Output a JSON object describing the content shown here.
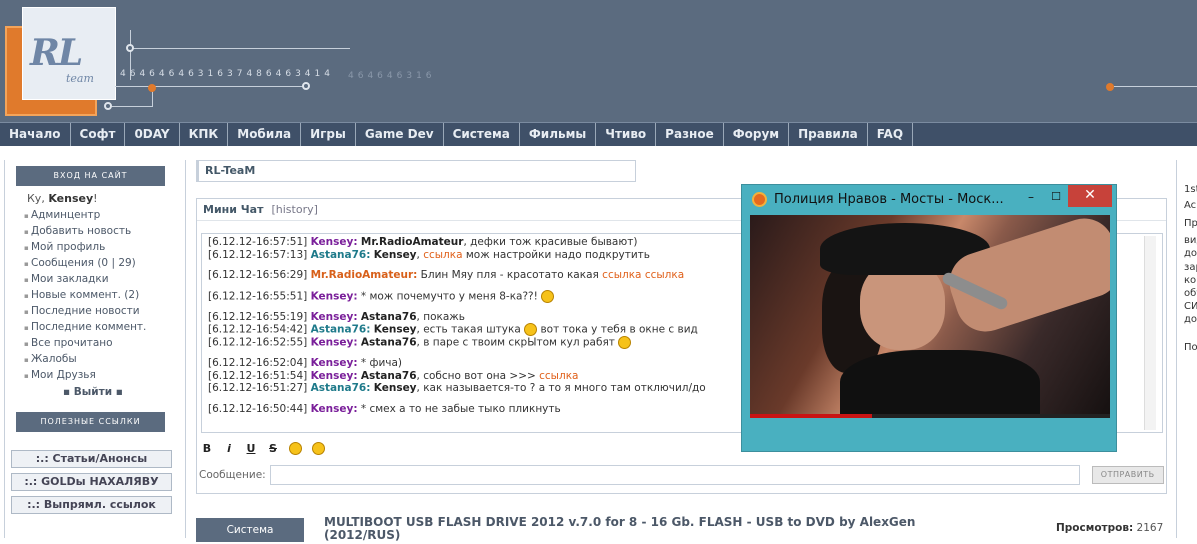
{
  "header": {
    "logo_text": "RL",
    "logo_sub": "team",
    "digits_bright": "4646464631637486463414",
    "digits_dim": "464646316"
  },
  "nav": [
    "Начало",
    "Софт",
    "0DAY",
    "КПК",
    "Мобила",
    "Игры",
    "Game Dev",
    "Система",
    "Фильмы",
    "Чтиво",
    "Разное",
    "Форум",
    "Правила",
    "FAQ"
  ],
  "sidebar": {
    "login_title": "ВХОД НА САЙТ",
    "greeting_prefix": "Ку,",
    "username": "Kensey",
    "greeting_suffix": "!",
    "menu": [
      "Админцентр",
      "Добавить новость",
      "Мой профиль",
      "Сообщения (0 | 29)",
      "Мои закладки",
      "Новые коммент. (2)",
      "Последние новости",
      "Последние коммент.",
      "Все прочитано",
      "Жалобы",
      "Мои Друзья"
    ],
    "logout": "Выйти",
    "links_title": "ПОЛЕЗНЫЕ ССЫЛКИ",
    "buttons": [
      ":.: Статьи/Анонсы",
      ":.: GOLDы НАХАЛЯВУ",
      ":.: Выпрямл. ссылок"
    ]
  },
  "main": {
    "site_title": "RL-TeaM",
    "chat_title": "Мини Чат",
    "chat_history": "[history]",
    "messages": [
      {
        "time": "[6.12.12-16:57:51]",
        "user": "Kensey:",
        "ucls": "u1",
        "to": "Mr.RadioAmateur",
        "text": ", дефки тож красивые бывают)",
        "link": "",
        "after": ""
      },
      {
        "time": "[6.12.12-16:57:13]",
        "user": "Astana76:",
        "ucls": "u2",
        "to": "Kensey",
        "text": ", ",
        "link": "ссылка",
        "after": " мож настройки надо подкрутить"
      },
      {
        "time": "[6.12.12-16:56:29]",
        "user": "Mr.RadioAmateur:",
        "ucls": "u3",
        "to": "",
        "text": "Блин Мяу пля - красотато какая ",
        "link": "ссылка ссылка",
        "after": ""
      },
      {
        "time": "[6.12.12-16:55:51]",
        "user": "Kensey:",
        "ucls": "u1",
        "to": "",
        "text": "* мож почемучто у меня 8-ка??!",
        "link": "",
        "after": ""
      },
      {
        "time": "[6.12.12-16:55:19]",
        "user": "Kensey:",
        "ucls": "u1",
        "to": "Astana76",
        "text": ", покажь",
        "link": "",
        "after": ""
      },
      {
        "time": "[6.12.12-16:54:42]",
        "user": "Astana76:",
        "ucls": "u2",
        "to": "Kensey",
        "text": ", есть такая штука",
        "link": "",
        "after": " вот тока у тебя в окне с вид"
      },
      {
        "time": "[6.12.12-16:52:55]",
        "user": "Kensey:",
        "ucls": "u1",
        "to": "Astana76",
        "text": ", в паре с твоим скрЫтом кул рабят",
        "link": "",
        "after": ""
      },
      {
        "time": "[6.12.12-16:52:04]",
        "user": "Kensey:",
        "ucls": "u1",
        "to": "",
        "text": "* фича)",
        "link": "",
        "after": ""
      },
      {
        "time": "[6.12.12-16:51:54]",
        "user": "Kensey:",
        "ucls": "u1",
        "to": "Astana76",
        "text": ", собсно вот она >>> ",
        "link": "ссылка",
        "after": ""
      },
      {
        "time": "[6.12.12-16:51:27]",
        "user": "Astana76:",
        "ucls": "u2",
        "to": "Kensey",
        "text": ", как называется-то ? а то я много там отключил/до",
        "link": "",
        "after": ""
      },
      {
        "time": "[6.12.12-16:50:44]",
        "user": "Kensey:",
        "ucls": "u1",
        "to": "",
        "text": "* смех а то не забые тыко пликнуть",
        "link": "",
        "after": ""
      }
    ],
    "toolbar": [
      "B",
      "i",
      "U",
      "S"
    ],
    "message_label": "Сообщение:",
    "send_label": "ОТПРАВИТЬ",
    "news": {
      "category": "Система",
      "title": "MULTIBOOT USB FLASH DRIVE 2012 v.7.0 for 8 - 16 Gb. FLASH - USB to DVD by AlexGen (2012/RUS)",
      "views_label": "Просмотров:",
      "views_value": "2167"
    }
  },
  "right": {
    "lines": [
      "1st",
      "Ac",
      "Пр",
      "вид",
      "дон",
      "зар",
      "ком",
      "обу",
      "СИ",
      "дос",
      "Поі"
    ]
  },
  "popup": {
    "title": "Полиция Нравов - Мосты - Моск...",
    "minimize": "–",
    "maximize": "☐",
    "close": "✕",
    "progress": 0.34
  },
  "colors": {
    "header": "#5b6b7f",
    "nav": "#3f5068",
    "accent": "#e07a2c",
    "link": "#e0601a",
    "popup_frame": "#49b0c0",
    "close": "#c7423a"
  }
}
